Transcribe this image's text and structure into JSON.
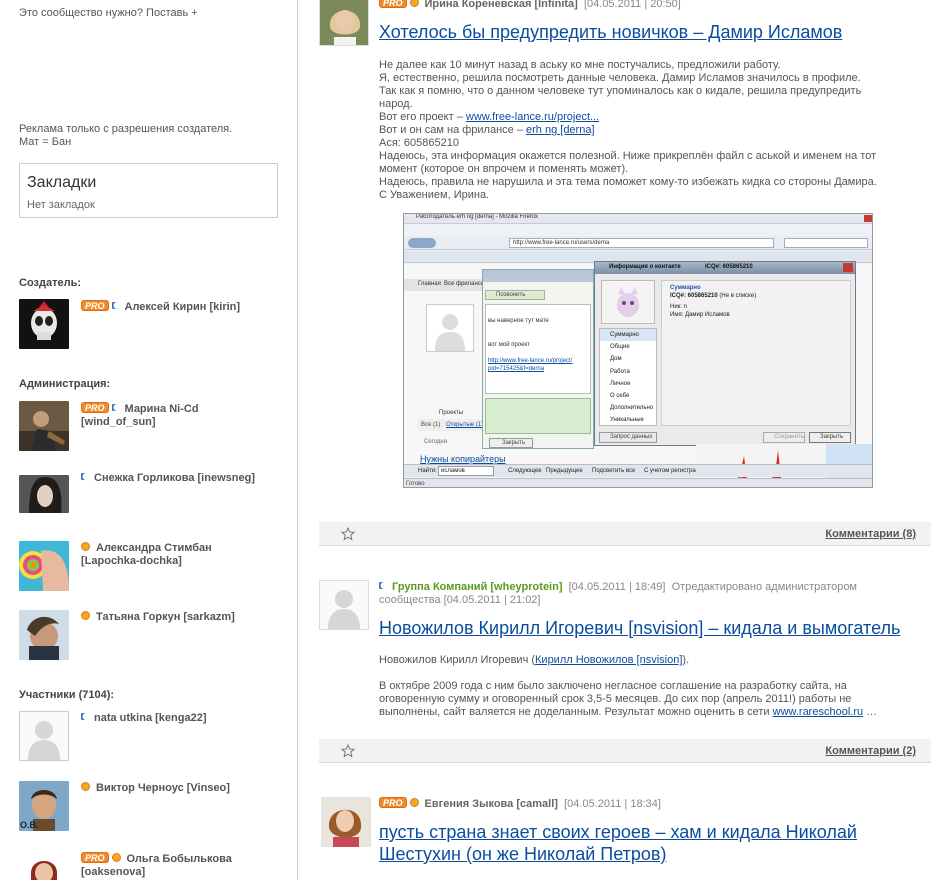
{
  "sidebar": {
    "need_community": "Это сообщество нужно? Поставь +",
    "ads_line1": "Реклама только с разрешения создателя.",
    "ads_line2": "Мат = Бан",
    "bookmarks_title": "Закладки",
    "bookmarks_empty": "Нет закладок",
    "creator_heading": "Создатель:",
    "admin_heading": "Администрация:",
    "members_heading": "Участники (7104):",
    "pro_label": "PRO",
    "creator": {
      "name": "Алексей Кирин [kirin]"
    },
    "admins": [
      {
        "name_line1": "Марина Ni-Cd",
        "name_line2": "[wind_of_sun]"
      },
      {
        "name_line1": "Снежка Горликова [inewsneg]",
        "name_line2": ""
      },
      {
        "name_line1": "Александра Стимбан",
        "name_line2": "[Lapochka-dochka]"
      },
      {
        "name_line1": "Татьяна Горкун [sarkazm]",
        "name_line2": ""
      }
    ],
    "members": [
      {
        "name_line1": "nata utkina [kenga22]",
        "name_line2": ""
      },
      {
        "name_line1": "Виктор Черноус [Vinseo]",
        "name_line2": ""
      },
      {
        "name_line1": "Ольга Бобылькова",
        "name_line2": "[oaksenova]"
      }
    ],
    "member_caption": "O.B."
  },
  "posts": [
    {
      "author": "Ирина Кореневская [Infinita]",
      "date": "[04.05.2011 | 20:50]",
      "title": "Хотелось бы предупредить новичков – Дамир Исламов",
      "lines": [
        "Не далее как 10 минут назад в аську ко мне постучались, предложили работу.",
        "Я, естественно, решила посмотреть данные человека. Дамир Исламов значилось в профиле.",
        "Так как я помню, что о данном человеке тут упоминалось как о кидале, решила предупредить народ."
      ],
      "project_prefix": "Вот его проект – ",
      "project_link": "www.free-lance.ru/project...",
      "freelance_prefix": "Вот и он сам на фрилансе – ",
      "freelance_link": "erh ng [derna]",
      "icq": "Ася: 605865210",
      "tail": [
        "Надеюсь, эта информация окажется полезной. Ниже прикреплён файл с аськой и именем на тот момент (которое он впрочем и поменять может).",
        "Надеюсь, правила не нарушила и эта тема поможет кому-то избежать кидка со стороны Дамира.",
        "С Уважением, Ирина."
      ],
      "comments": "Комментарии (8)",
      "screenshot": {
        "window_title": "Работодатель erh ng [derna] - Mozilla Firefox",
        "url": "http://www.free-lance.ru/users/derna",
        "icq_title": "Информация о контакте",
        "icq_number": "ICQ#: 605865210",
        "icq_status": "(Не в списке)",
        "nick": "Ник: n",
        "name": "Имя: Дамир Исламов",
        "summary": "Суммарно",
        "menu": [
          "Суммарно",
          "Общие",
          "Дом",
          "Работа",
          "Личное",
          "О себе",
          "Дополнительно",
          "Уникальные"
        ],
        "chat_lines": [
          "вы наверное тут мате",
          "вот мой проект",
          "http://www.free-lance.ru/project/",
          "pid=715425&f=derna"
        ],
        "request": "Запрос данных",
        "close": "Закрыть",
        "save": "Сохранить",
        "need_copywriters": "Нужны копирайтеры",
        "find_label": "Найти:",
        "find_value": "исламов",
        "find_next": "Следующее",
        "find_prev": "Предыдущее",
        "highlight": "Подсветить все",
        "match_case": "С учетом регистра",
        "done": "Готово",
        "tabs": [
          "Главная",
          "Все фрилансеры",
          "Проекты"
        ],
        "all_tab": "Все (1)",
        "open_tab": "Открытые (1)",
        "today": "Сегодня",
        "reply": "Позвонить",
        "project_block": "Проекты"
      }
    },
    {
      "author": "Группа Компаний [wheyprotein]",
      "date": "[04.05.2011 | 18:49]",
      "edited": "Отредактировано администратором",
      "edited_line2": "сообщества [04.05.2011 | 21:02]",
      "title": "Новожилов Кирилл Игоревич [nsvision] – кидала и вымогатель",
      "intro_prefix": "Новожилов Кирилл Игоревич (",
      "intro_link": "Кирилл Новожилов [nsvision]",
      "intro_suffix": ").",
      "paragraph": "В октябре 2009 года с ним было заключено негласное соглашение на разработку сайта, на оговоренную сумму и оговоренный срок 3,5-5 месяцев. До сих пор (апрель 2011!) работы не выполнены, сайт валяется не доделанным. Результат можно оценить в сети ",
      "paragraph_link": "www.rareschool.ru",
      "paragraph_end": " …",
      "comments": "Комментарии (2)"
    },
    {
      "author": "Евгения Зыкова [camall]",
      "date": "[04.05.2011 | 18:34]",
      "title_line1": "пусть страна знает своих героев – хам и кидала Николай",
      "title_line2": "Шестухин (он же Николай Петров)"
    }
  ],
  "colors": {
    "link": "#0b4c9f",
    "pro": "#f08c2c",
    "green_author": "#5c9a19"
  }
}
